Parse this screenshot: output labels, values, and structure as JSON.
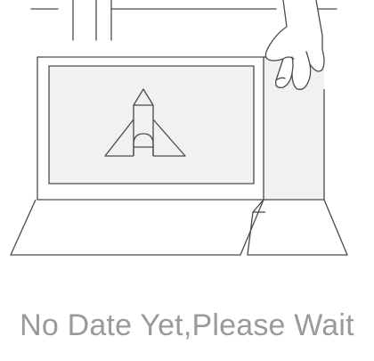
{
  "empty_state": {
    "message": "No Date Yet,Please Wait",
    "illustration_icon": "laptop-with-hand-icon",
    "rocket_icon": "rocket-icon",
    "hand_icon": "hand-icon"
  },
  "colors": {
    "line": "#4a4a4a",
    "screen_fill": "#f1f1f2",
    "message_text": "#9a9a9a",
    "background": "#ffffff"
  }
}
